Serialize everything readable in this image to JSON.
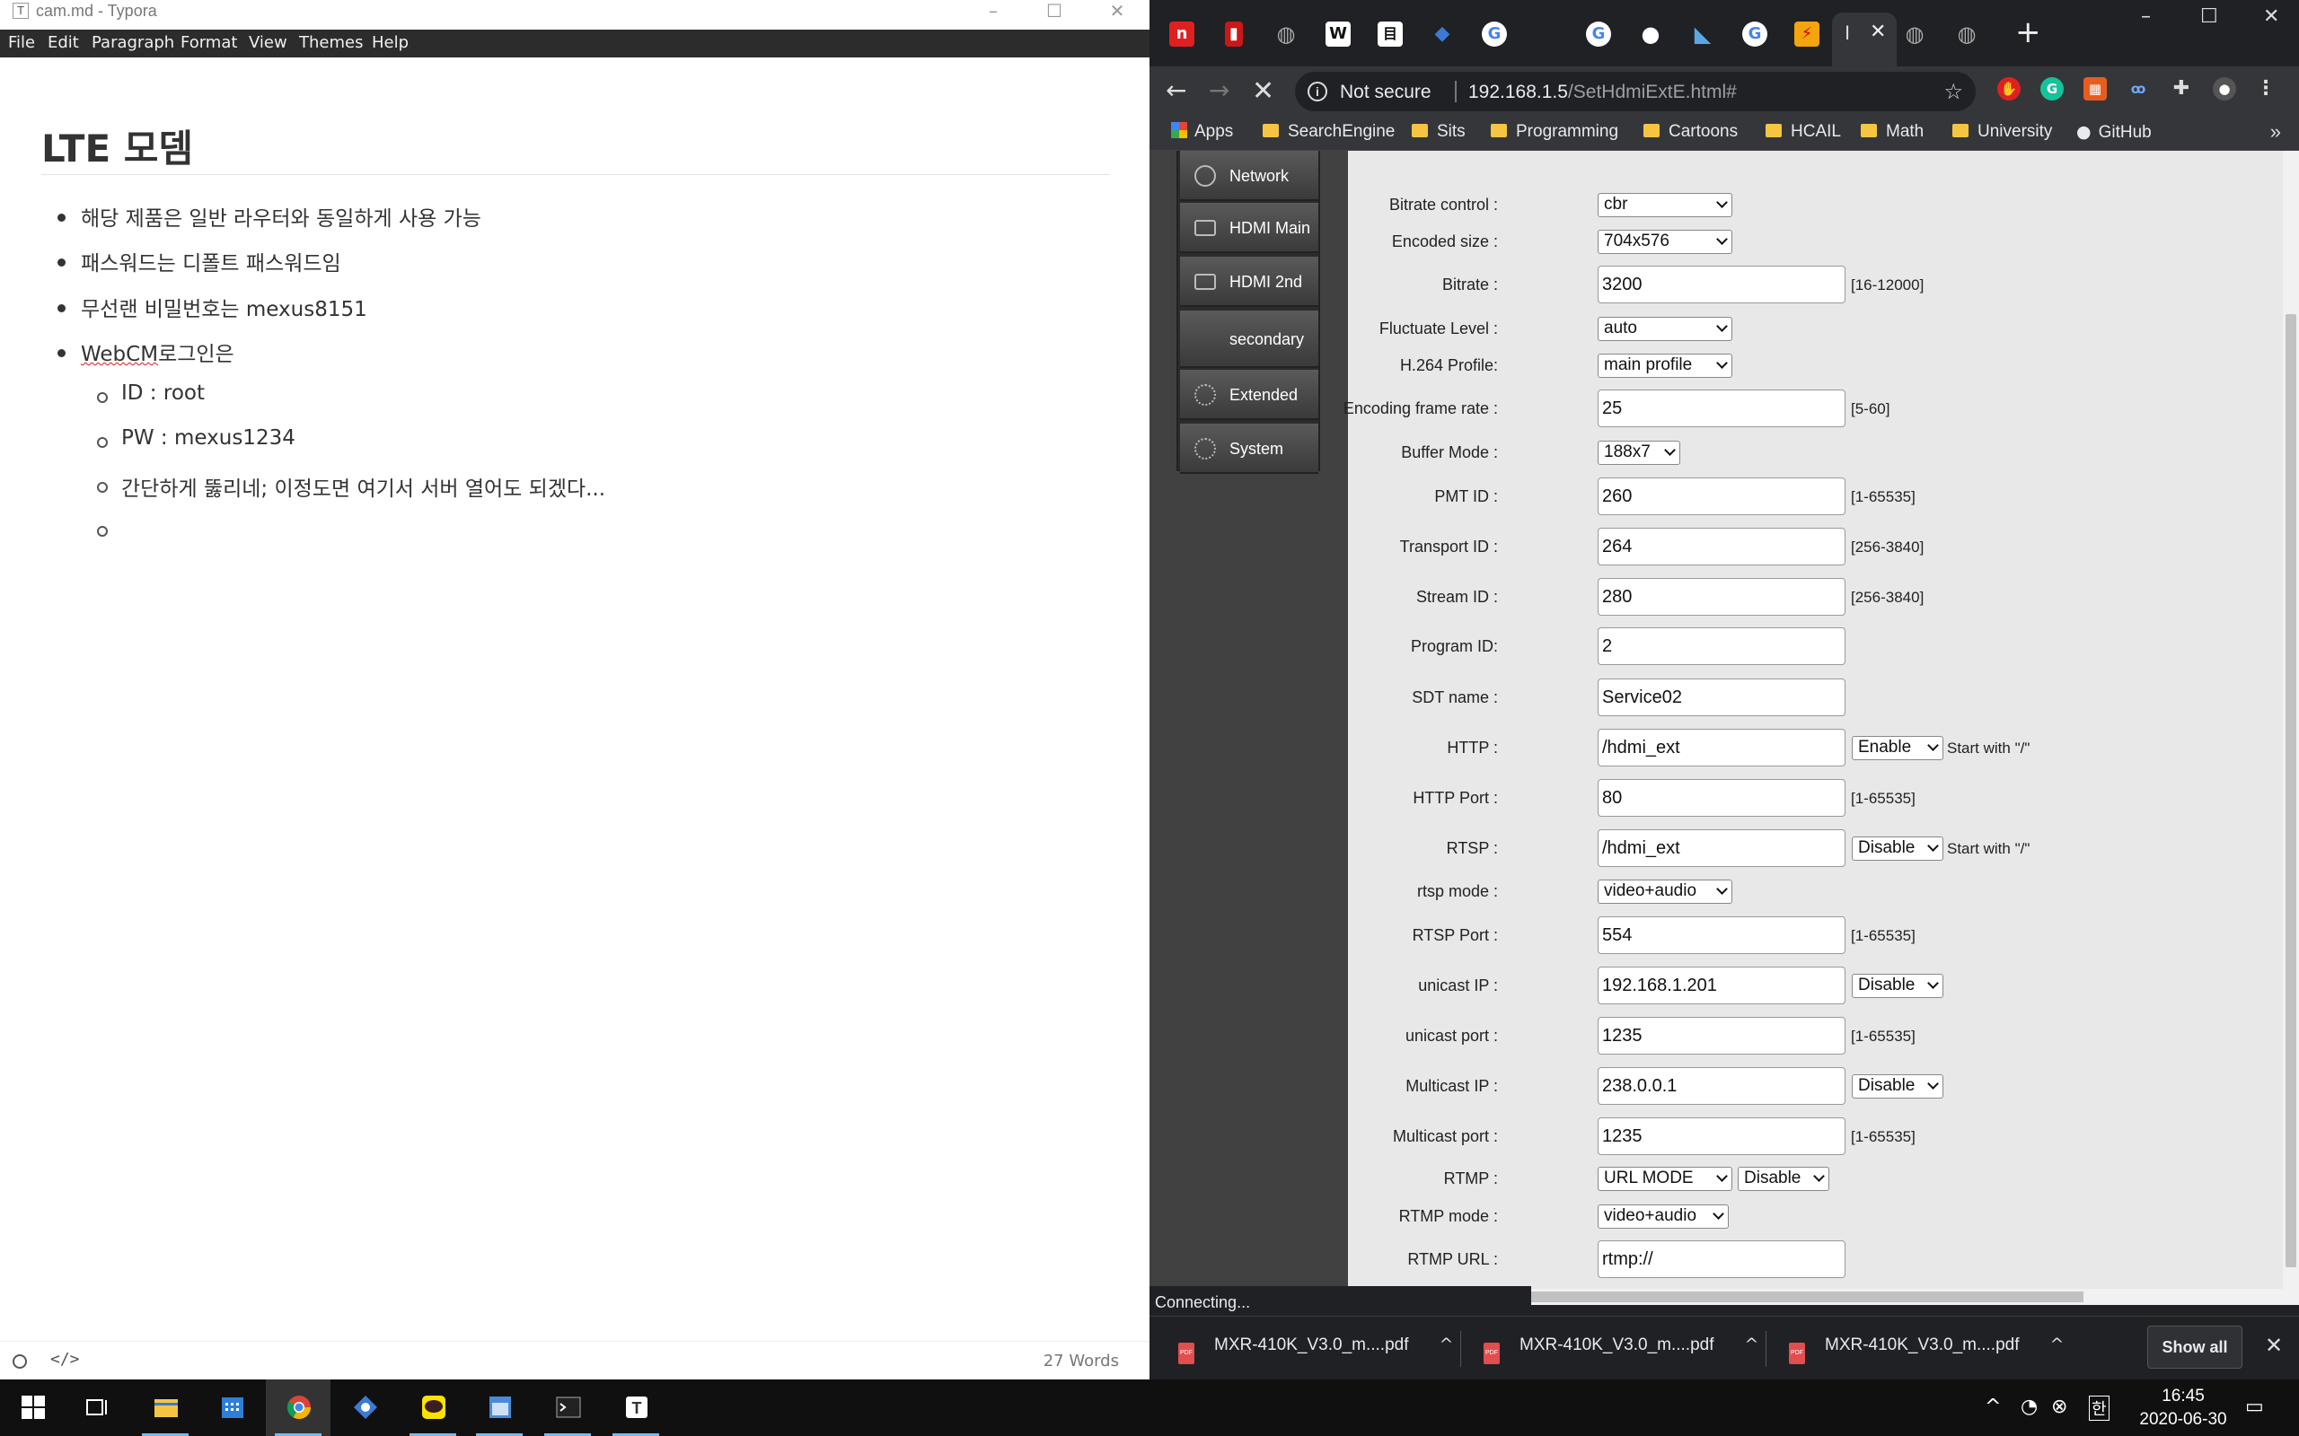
{
  "typora": {
    "window_title": "cam.md - Typora",
    "menu": [
      "File",
      "Edit",
      "Paragraph",
      "Format",
      "View",
      "Themes",
      "Help"
    ],
    "heading": "LTE 모뎀",
    "bullets": [
      "해당 제품은 일반 라우터와 동일하게 사용 가능",
      "패스워드는 디폴트 패스워드임",
      "무선랜 비밀번호는 mexus8151"
    ],
    "bullet4_a": "WebCM",
    "bullet4_b": "로그인은",
    "sub": [
      "ID : root",
      "PW : mexus1234",
      "간단하게 뚫리네; 이정도면 여기서 서버 열어도 되겠다..."
    ],
    "word_count": "27 Words"
  },
  "chrome": {
    "active_tab_label": "I",
    "url_security": "Not secure",
    "url_host": "192.168.1.5",
    "url_path": "/SetHdmiExtE.html#",
    "bookmarks": [
      "Apps",
      "SearchEngine",
      "Sits",
      "Programming",
      "Cartoons",
      "HCAIL",
      "Math",
      "University",
      "GitHub"
    ],
    "status": "Connecting...",
    "downloads": [
      "MXR-410K_V3.0_m....pdf",
      "MXR-410K_V3.0_m....pdf",
      "MXR-410K_V3.0_m....pdf"
    ],
    "show_all": "Show all"
  },
  "device": {
    "nav": [
      "Network",
      "HDMI Main",
      "HDMI 2nd",
      "secondary",
      "Extended",
      "System"
    ],
    "fields": {
      "bitrate_control": {
        "label": "Bitrate control :",
        "value": "cbr"
      },
      "encoded_size": {
        "label": "Encoded size :",
        "value": "704x576"
      },
      "bitrate": {
        "label": "Bitrate :",
        "value": "3200",
        "range": "[16-12000]"
      },
      "fluctuate": {
        "label": "Fluctuate Level :",
        "value": "auto"
      },
      "h264": {
        "label": "H.264 Profile:",
        "value": "main profile"
      },
      "framerate": {
        "label": "Encoding frame rate :",
        "value": "25",
        "range": "[5-60]"
      },
      "buffer": {
        "label": "Buffer Mode :",
        "value": "188x7"
      },
      "pmt": {
        "label": "PMT ID :",
        "value": "260",
        "range": "[1-65535]"
      },
      "transport": {
        "label": "Transport ID :",
        "value": "264",
        "range": "[256-3840]"
      },
      "stream": {
        "label": "Stream ID :",
        "value": "280",
        "range": "[256-3840]"
      },
      "program": {
        "label": "Program ID:",
        "value": "2"
      },
      "sdt": {
        "label": "SDT name :",
        "value": "Service02"
      },
      "http": {
        "label": "HTTP :",
        "value": "/hdmi_ext",
        "select": "Enable",
        "hint": "Start with \"/\""
      },
      "http_port": {
        "label": "HTTP Port :",
        "value": "80",
        "range": "[1-65535]"
      },
      "rtsp": {
        "label": "RTSP :",
        "value": "/hdmi_ext",
        "select": "Disable",
        "hint": "Start with \"/\""
      },
      "rtsp_mode": {
        "label": "rtsp mode :",
        "value": "video+audio"
      },
      "rtsp_port": {
        "label": "RTSP Port :",
        "value": "554",
        "range": "[1-65535]"
      },
      "unicast_ip": {
        "label": "unicast IP :",
        "value": "192.168.1.201",
        "select": "Disable"
      },
      "unicast_port": {
        "label": "unicast port :",
        "value": "1235",
        "range": "[1-65535]"
      },
      "multicast_ip": {
        "label": "Multicast IP :",
        "value": "238.0.0.1",
        "select": "Disable"
      },
      "multicast_port": {
        "label": "Multicast port :",
        "value": "1235",
        "range": "[1-65535]"
      },
      "rtmp": {
        "label": "RTMP :",
        "value": "URL MODE",
        "select": "Disable"
      },
      "rtmp_mode": {
        "label": "RTMP mode :",
        "value": "video+audio"
      },
      "rtmp_url": {
        "label": "RTMP URL :",
        "value": "rtmp://"
      }
    }
  },
  "taskbar": {
    "time": "16:45",
    "date": "2020-06-30",
    "ime": "한"
  }
}
